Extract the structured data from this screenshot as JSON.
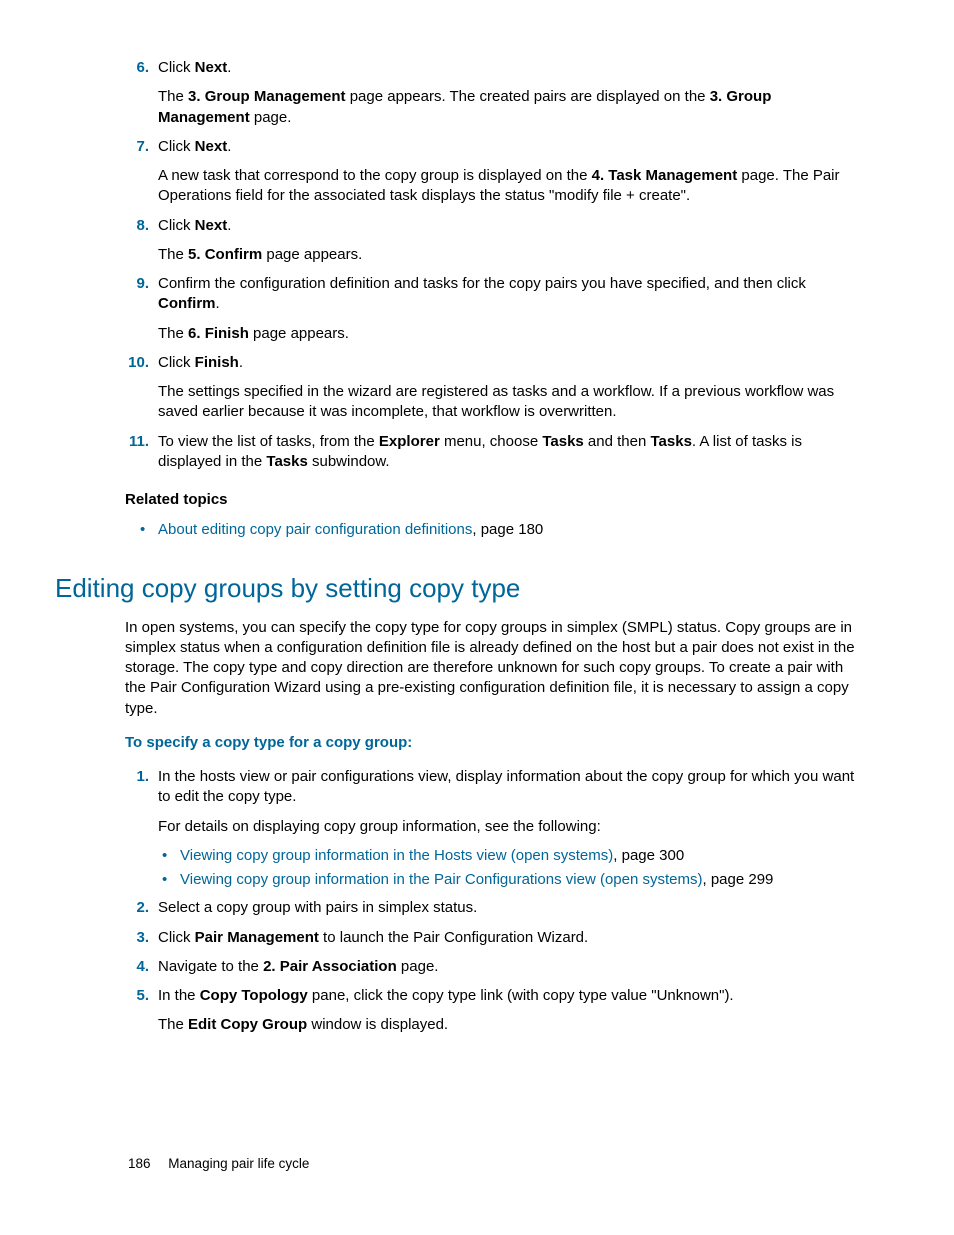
{
  "steps_a": [
    {
      "num": "6.",
      "lines": [
        {
          "type": "p",
          "runs": [
            {
              "t": "Click "
            },
            {
              "t": "Next",
              "b": true
            },
            {
              "t": "."
            }
          ]
        },
        {
          "type": "p",
          "runs": [
            {
              "t": "The "
            },
            {
              "t": "3. Group Management",
              "b": true
            },
            {
              "t": " page appears. The created pairs are displayed on the "
            },
            {
              "t": "3. Group Management",
              "b": true
            },
            {
              "t": " page."
            }
          ]
        }
      ]
    },
    {
      "num": "7.",
      "lines": [
        {
          "type": "p",
          "runs": [
            {
              "t": "Click "
            },
            {
              "t": "Next",
              "b": true
            },
            {
              "t": "."
            }
          ]
        },
        {
          "type": "p",
          "runs": [
            {
              "t": "A new task that correspond to the copy group is displayed on the "
            },
            {
              "t": "4. Task Management",
              "b": true
            },
            {
              "t": " page. The Pair Operations field for the associated task displays the status \"modify file + create\"."
            }
          ]
        }
      ]
    },
    {
      "num": "8.",
      "lines": [
        {
          "type": "p",
          "runs": [
            {
              "t": "Click "
            },
            {
              "t": "Next",
              "b": true
            },
            {
              "t": "."
            }
          ]
        },
        {
          "type": "p",
          "runs": [
            {
              "t": "The "
            },
            {
              "t": "5. Confirm",
              "b": true
            },
            {
              "t": " page appears."
            }
          ]
        }
      ]
    },
    {
      "num": "9.",
      "lines": [
        {
          "type": "p",
          "runs": [
            {
              "t": "Confirm the configuration definition and tasks for the copy pairs you have specified, and then click "
            },
            {
              "t": "Confirm",
              "b": true
            },
            {
              "t": "."
            }
          ]
        },
        {
          "type": "p",
          "runs": [
            {
              "t": "The "
            },
            {
              "t": "6. Finish",
              "b": true
            },
            {
              "t": " page appears."
            }
          ]
        }
      ]
    },
    {
      "num": "10.",
      "lines": [
        {
          "type": "p",
          "runs": [
            {
              "t": "Click "
            },
            {
              "t": "Finish",
              "b": true
            },
            {
              "t": "."
            }
          ]
        },
        {
          "type": "p",
          "runs": [
            {
              "t": "The settings specified in the wizard are registered as tasks and a workflow. If a previous workflow was saved earlier because it was incomplete, that workflow is overwritten."
            }
          ]
        }
      ]
    },
    {
      "num": "11.",
      "lines": [
        {
          "type": "p",
          "runs": [
            {
              "t": "To view the list of tasks, from the "
            },
            {
              "t": "Explorer",
              "b": true
            },
            {
              "t": " menu, choose "
            },
            {
              "t": "Tasks",
              "b": true
            },
            {
              "t": " and then "
            },
            {
              "t": "Tasks",
              "b": true
            },
            {
              "t": ". A list of tasks is displayed in the "
            },
            {
              "t": "Tasks",
              "b": true
            },
            {
              "t": " subwindow."
            }
          ]
        }
      ]
    }
  ],
  "related_heading": "Related topics",
  "related_links": [
    {
      "text": "About editing copy pair configuration definitions",
      "suffix": ", page 180"
    }
  ],
  "section_title": "Editing copy groups by setting copy type",
  "intro": "In open systems, you can specify the copy type for copy groups in simplex (SMPL) status. Copy groups are in simplex status when a configuration definition file is already defined on the host but a pair does not exist in the storage.  The copy type and copy direction are therefore unknown for such copy groups. To create a pair with the Pair Configuration Wizard using a pre-existing configuration definition file, it is necessary to assign a copy type.",
  "subheading": "To specify a copy type for a copy group:",
  "steps_b": [
    {
      "num": "1.",
      "lines": [
        {
          "type": "p",
          "runs": [
            {
              "t": "In the hosts view or pair configurations view, display information about the copy group for which you want to edit the copy type."
            }
          ]
        },
        {
          "type": "p",
          "runs": [
            {
              "t": "For details on displaying copy group information, see the following:"
            }
          ]
        },
        {
          "type": "ul",
          "items": [
            {
              "link": "Viewing copy group information in the Hosts view (open systems)",
              "suffix": ", page 300"
            },
            {
              "link": "Viewing copy group information in the Pair Configurations view (open systems)",
              "suffix": ", page 299"
            }
          ]
        }
      ]
    },
    {
      "num": "2.",
      "lines": [
        {
          "type": "p",
          "runs": [
            {
              "t": "Select a copy group with pairs in simplex status."
            }
          ]
        }
      ]
    },
    {
      "num": "3.",
      "lines": [
        {
          "type": "p",
          "runs": [
            {
              "t": "Click "
            },
            {
              "t": "Pair Management",
              "b": true
            },
            {
              "t": " to launch the Pair Configuration Wizard."
            }
          ]
        }
      ]
    },
    {
      "num": "4.",
      "lines": [
        {
          "type": "p",
          "runs": [
            {
              "t": "Navigate to the "
            },
            {
              "t": "2. Pair Association",
              "b": true
            },
            {
              "t": " page."
            }
          ]
        }
      ]
    },
    {
      "num": "5.",
      "lines": [
        {
          "type": "p",
          "runs": [
            {
              "t": "In the "
            },
            {
              "t": "Copy Topology",
              "b": true
            },
            {
              "t": " pane, click the copy type link (with copy type value \"Unknown\")."
            }
          ]
        },
        {
          "type": "p",
          "runs": [
            {
              "t": "The "
            },
            {
              "t": "Edit Copy Group",
              "b": true
            },
            {
              "t": " window is displayed."
            }
          ]
        }
      ]
    }
  ],
  "footer": {
    "page": "186",
    "title": "Managing pair life cycle"
  }
}
